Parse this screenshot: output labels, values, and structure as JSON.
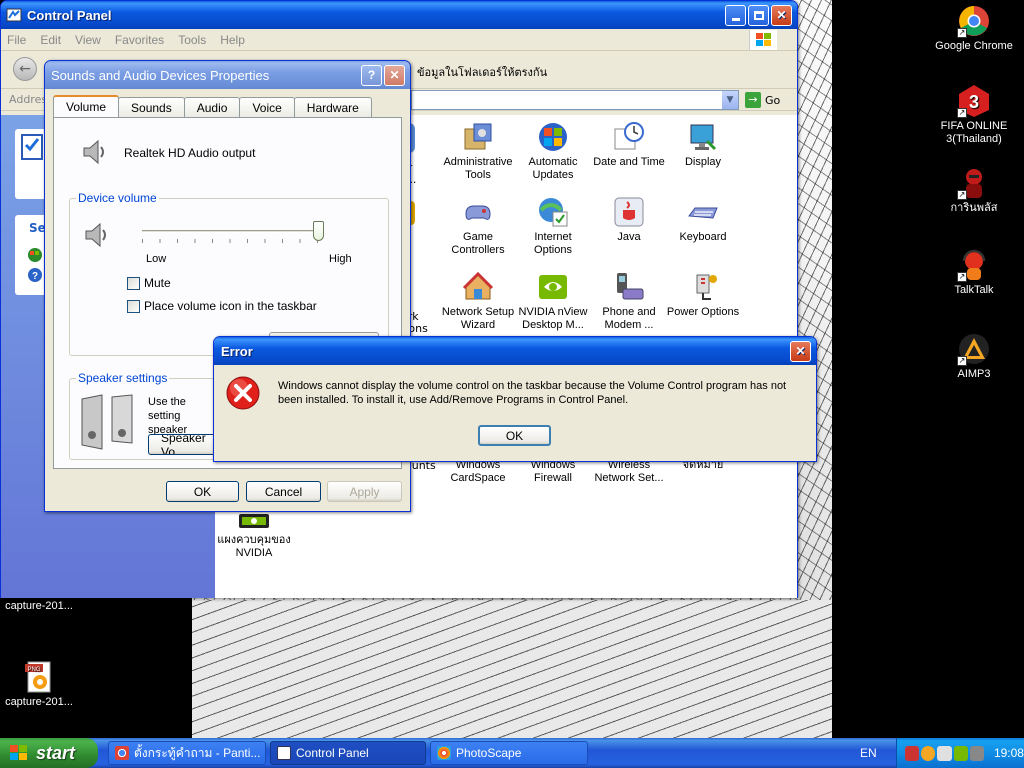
{
  "desktop": {
    "icons": [
      {
        "label": "Google Chrome"
      },
      {
        "label": "FIFA ONLINE 3(Thailand)"
      },
      {
        "label": "การินพลัส"
      },
      {
        "label": "TalkTalk"
      },
      {
        "label": "AIMP3"
      },
      {
        "label": "แผงควบคุมของ NVIDIA"
      },
      {
        "label": "capture-201..."
      },
      {
        "label": "capture-201..."
      }
    ]
  },
  "control_panel": {
    "title": "Control Panel",
    "menu": [
      "File",
      "Edit",
      "View",
      "Favorites",
      "Tools",
      "Help"
    ],
    "address_label": "Address",
    "address_hint": "ข้อมูลในโฟลเดอร์ให้ตรงกัน",
    "go_label": "Go",
    "side_heading": "Se",
    "items": [
      {
        "label": "Administrative Tools"
      },
      {
        "label": "Automatic Updates"
      },
      {
        "label": "Date and Time"
      },
      {
        "label": "Display"
      },
      {
        "label": "Game Controllers"
      },
      {
        "label": "Internet Options"
      },
      {
        "label": "Java"
      },
      {
        "label": "Keyboard"
      },
      {
        "label": "Network Setup Wizard"
      },
      {
        "label": "NVIDIA nView Desktop M..."
      },
      {
        "label": "Phone and Modem ..."
      },
      {
        "label": "Power Options"
      },
      {
        "label": "Windows CardSpace"
      },
      {
        "label": "Windows Firewall"
      },
      {
        "label": "Wireless Network Set..."
      },
      {
        "label": "จดหมาย"
      }
    ],
    "partial_labels": [
      "or",
      "y...",
      "ts",
      "ork",
      "tions",
      "ounts"
    ]
  },
  "sounds_dialog": {
    "title": "Sounds and Audio Devices Properties",
    "help_btn": "?",
    "close_btn": "✕",
    "tabs": [
      "Volume",
      "Sounds",
      "Audio",
      "Voice",
      "Hardware"
    ],
    "device_name": "Realtek HD Audio output",
    "device_volume_legend": "Device volume",
    "slider_low": "Low",
    "slider_high": "High",
    "volume_level": 1.0,
    "mute_label": "Mute",
    "tray_icon_label": "Place volume icon in the taskbar",
    "speaker_legend": "Speaker settings",
    "speaker_text": "Use the setting speaker volum",
    "speaker_volume_button": "Speaker Vo",
    "ok": "OK",
    "cancel": "Cancel",
    "apply": "Apply"
  },
  "error_dialog": {
    "title": "Error",
    "message": "Windows cannot display the volume control on the taskbar because the Volume Control program has not been installed. To install it, use Add/Remove Programs in Control Panel.",
    "ok": "OK",
    "close_btn": "✕"
  },
  "taskbar": {
    "start_label": "start",
    "tasks": [
      {
        "label": "ตั้งกระทู้คำถาม - Panti..."
      },
      {
        "label": "Control Panel"
      },
      {
        "label": "PhotoScape"
      }
    ],
    "language": "EN",
    "clock": "19:08"
  },
  "colors": {
    "xp_title_blue": "#0b59e0",
    "error_red": "#e0201b",
    "start_green": "#3c9a3c"
  }
}
